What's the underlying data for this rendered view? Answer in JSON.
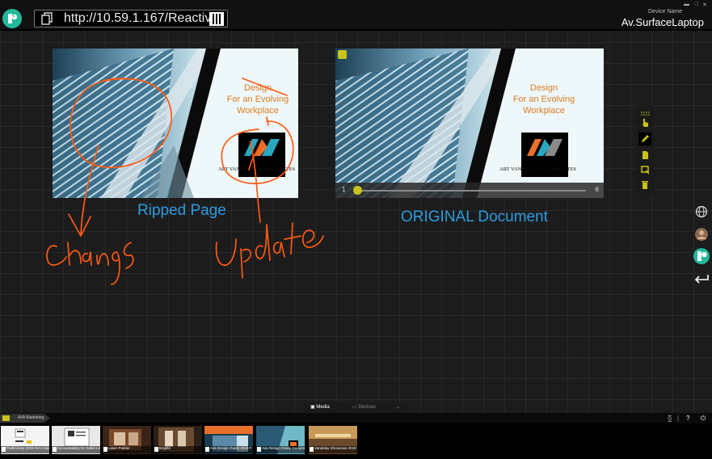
{
  "header": {
    "url": "http://10.59.1.167/Reactiv/",
    "device_label": "Device Name",
    "device_name": "Av.SurfaceLaptop"
  },
  "slides": {
    "design_line1": "Design",
    "design_line2": "For an Evolving",
    "design_line3": "Workplace",
    "company": "ART VANDELAY & ASSOCIATES"
  },
  "captions": {
    "left": "Ripped Page",
    "right": "ORIGINAL Document"
  },
  "annotations": {
    "left_word": "Change",
    "right_word": "Update"
  },
  "player": {
    "start": "1",
    "end": "6",
    "position_fraction": 0.0
  },
  "tabs": {
    "media": "Media",
    "devices": "Devices"
  },
  "folder": {
    "label": "AVA Marketing"
  },
  "bottom_controls": {
    "help": "?"
  },
  "thumbnails": [
    {
      "label": "Preliminary 2019 AVA Catalog"
    },
    {
      "label": "Accountability for Sales Leaders"
    },
    {
      "label": "Laser Pointer"
    },
    {
      "label": "Brigitte"
    },
    {
      "label": "Ava Design Guide 2019 F"
    },
    {
      "label": "Ava Design Guide Document"
    },
    {
      "label": "Vandelay Showcase 2019"
    }
  ],
  "colors": {
    "accent_yellow": "#c9c21a",
    "caption_blue": "#2e9be0",
    "ink_orange": "#ff5a12",
    "brand_teal": "#22b89a"
  }
}
